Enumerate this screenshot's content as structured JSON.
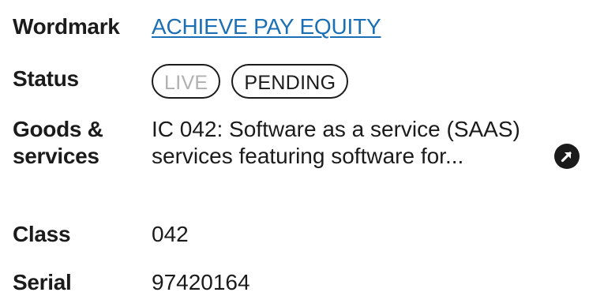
{
  "record": {
    "wordmark": {
      "label": "Wordmark",
      "value": "ACHIEVE PAY EQUITY"
    },
    "status": {
      "label": "Status",
      "badges": [
        {
          "text": "LIVE",
          "active": false
        },
        {
          "text": "PENDING",
          "active": true
        }
      ]
    },
    "goods": {
      "label_line1": "Goods &",
      "label_line2": "services",
      "value": "IC 042: Software as a service (SAAS) services featuring software for..."
    },
    "class": {
      "label": "Class",
      "value": "042"
    },
    "serial": {
      "label": "Serial",
      "value": "97420164"
    }
  },
  "icons": {
    "open_details": "arrow-up-right-circle-icon"
  },
  "colors": {
    "link": "#1a6fb5",
    "text": "#1b1b1b",
    "inactive_badge_text": "#b0b0b0",
    "icon_background": "#1b1b1b"
  }
}
